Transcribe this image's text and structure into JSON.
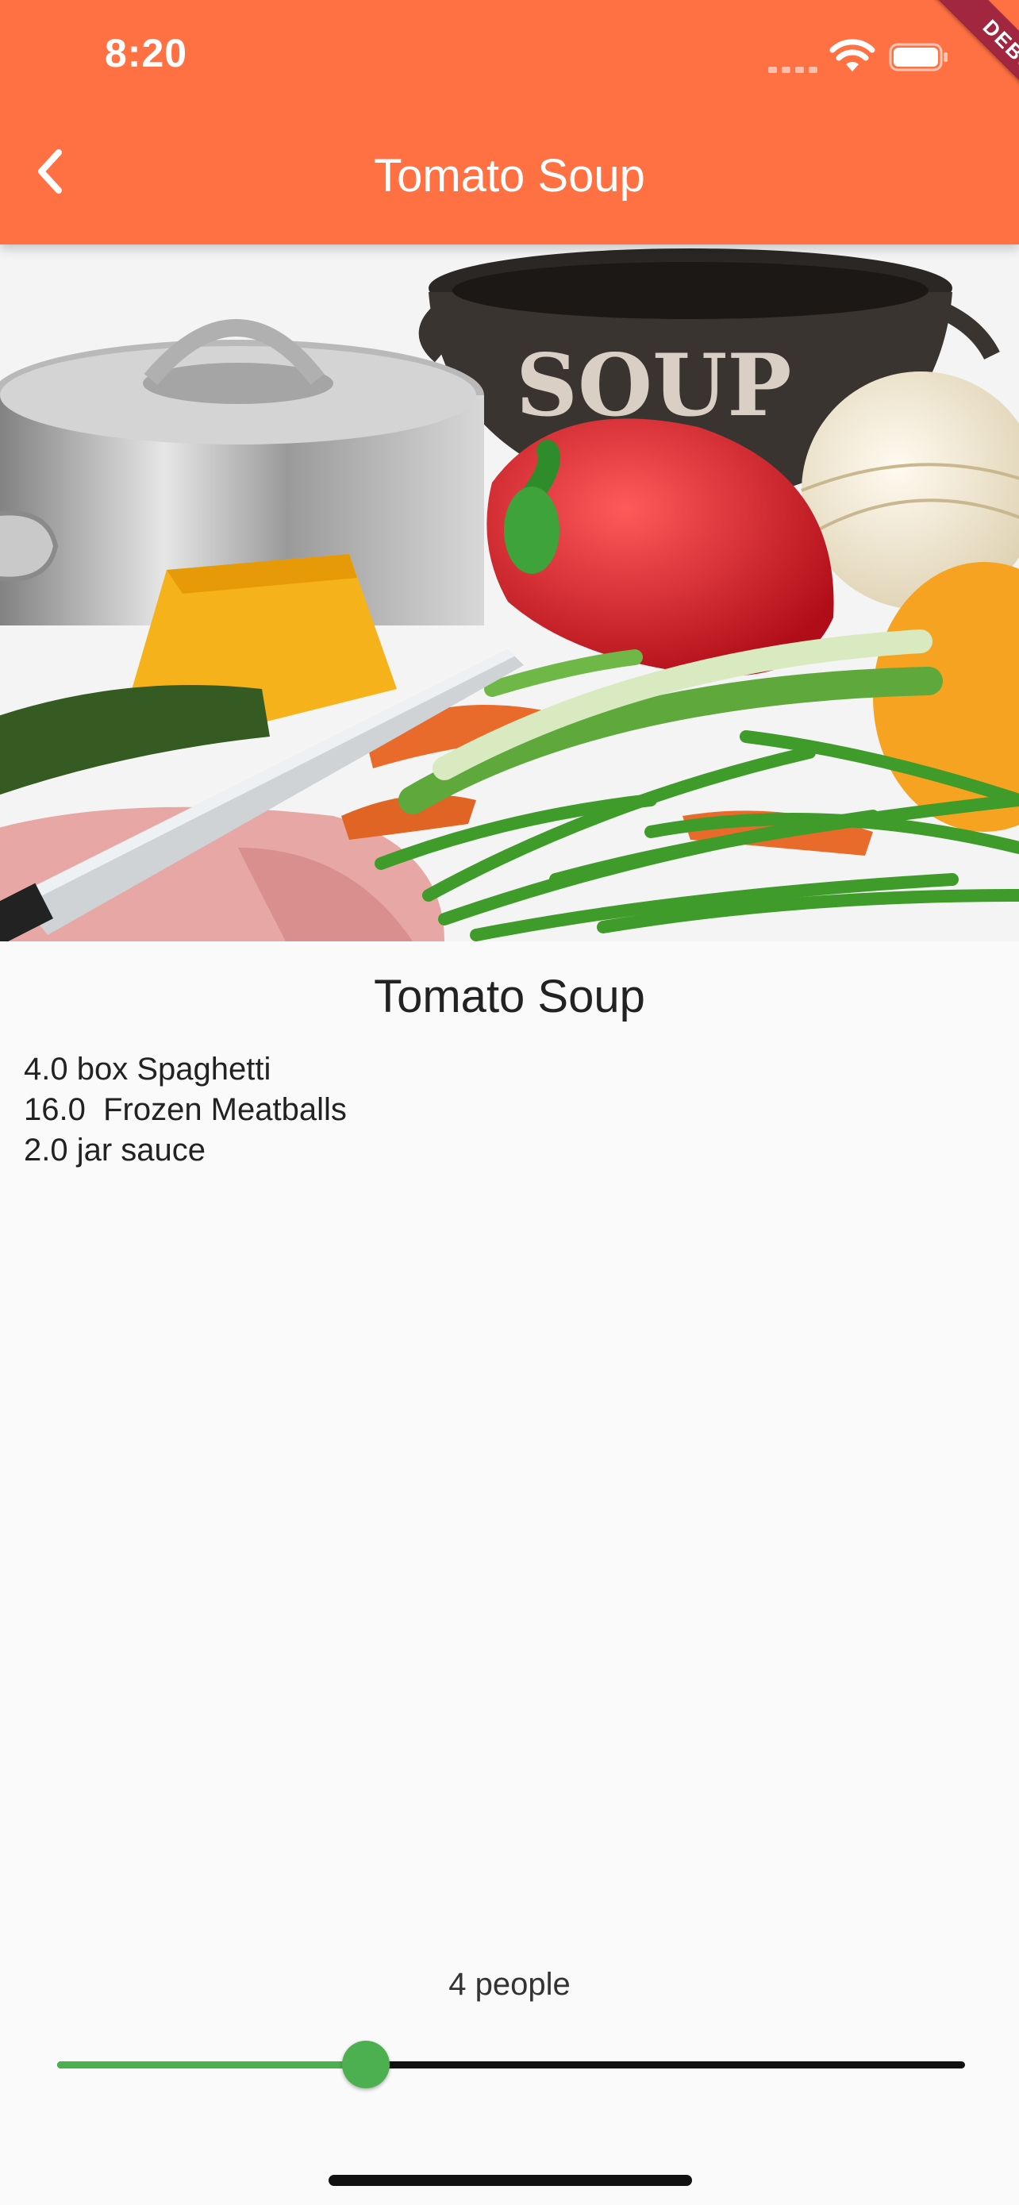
{
  "status_bar": {
    "time": "8:20"
  },
  "debug_banner": "DEBUG",
  "app_bar": {
    "title": "Tomato Soup",
    "back_icon": "chevron-left-icon"
  },
  "hero_image": {
    "description_icon": "cooking-vegetables-photo",
    "pot_text": "SOUP"
  },
  "recipe": {
    "title": "Tomato Soup",
    "ingredients": [
      "4.0 box Spaghetti",
      "16.0  Frozen Meatballs",
      "2.0 jar sauce"
    ]
  },
  "servings": {
    "label": "4 people",
    "slider_fraction": 0.34
  },
  "colors": {
    "app_bar": "#FF7043",
    "slider_active": "#4CAF50",
    "slider_inactive": "#111111",
    "background": "#FAFAFA"
  }
}
